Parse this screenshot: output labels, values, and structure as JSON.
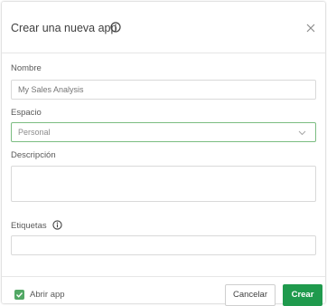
{
  "dialog": {
    "title": "Crear una nueva app",
    "title_icon": "info-icon",
    "close_icon": "close-icon"
  },
  "form": {
    "name_label": "Nombre",
    "name_placeholder": "My Sales Analysis",
    "space_label": "Espacio",
    "space_value": "Personal",
    "description_label": "Descripción",
    "tags_label": "Etiquetas",
    "tags_icon": "info-icon"
  },
  "footer": {
    "open_app_label": "Abrir app",
    "open_app_checked": true,
    "cancel_label": "Cancelar",
    "create_label": "Crear"
  },
  "colors": {
    "accent": "#1f9a4d",
    "checkbox": "#52a865",
    "focus_border": "#7cbd82"
  }
}
